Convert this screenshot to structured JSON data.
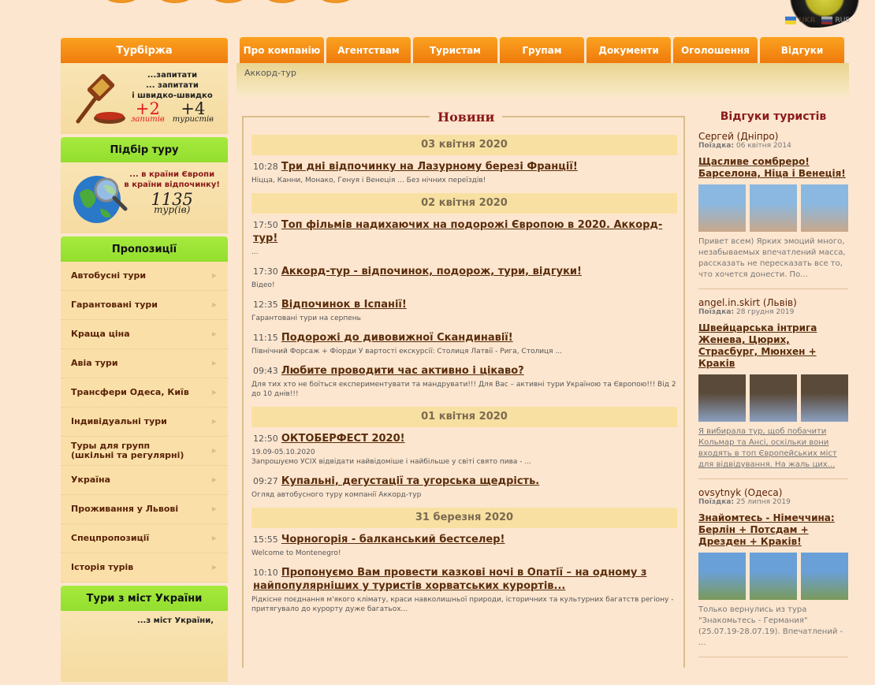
{
  "colors": {
    "accent_orange": "#f07c0e",
    "accent_green": "#9ee53a",
    "link": "#5a2d0c",
    "heading": "#8b1a1a",
    "background": "#fde6cf"
  },
  "languages": [
    {
      "code": "UKR",
      "icon": "flag-ukraine-icon"
    },
    {
      "code": "RUS",
      "icon": "flag-russia-icon"
    }
  ],
  "nav": {
    "tabs": [
      "Про компанію",
      "Агентствам",
      "Туристам",
      "Групам",
      "Документи",
      "Оголошення",
      "Відгуки"
    ]
  },
  "breadcrumb": "Аккорд-тур",
  "sidebar": {
    "turbirzha": {
      "title": "Турбіржа",
      "lines": [
        "...запитати",
        "... запитати",
        "і швидко-швидко"
      ],
      "requests_count": "+2",
      "requests_label": "запитів",
      "tourists_count": "+4",
      "tourists_label": "туристів"
    },
    "tour_search": {
      "title": "Підбір туру",
      "lines": [
        "... в країни Європи",
        "в країни відпочинку!"
      ],
      "count": "1135",
      "count_label": "тур(ів)"
    },
    "offers": {
      "title": "Пропозиції",
      "items": [
        "Автобусні тури",
        "Гарантовані тури",
        "Краща ціна",
        "Авіа тури",
        "Трансфери Одеса, Київ",
        "Індивідуальні тури",
        "Туры для групп\n(шкільні та регулярні)",
        "Україна",
        "Проживання у Львові",
        "Спецпропозиції",
        "Історія турів"
      ]
    },
    "cities": {
      "title": "Тури з міст України",
      "line": "...з міст України,"
    }
  },
  "news": {
    "title": "Новини",
    "groups": [
      {
        "date": "03 квітня 2020",
        "items": [
          {
            "time": "10:28",
            "title": "Три дні відпочинку на Лазурному березі Франції!",
            "desc": "Ніцца, Канни, Монако, Генуя і Венеція ... Без нічних переїздів!"
          }
        ]
      },
      {
        "date": "02 квітня 2020",
        "items": [
          {
            "time": "17:50",
            "title": "Топ фільмів надихаючих на подорожі Європою в 2020. Аккорд-тур!",
            "desc": "..."
          },
          {
            "time": "17:30",
            "title": "Аккорд-тур - відпочинок, подорож, тури, відгуки!",
            "desc": "Відео!"
          },
          {
            "time": "12:35",
            "title": "Відпочинок в Іспанії!",
            "desc": "Гарантовані тури на серпень"
          },
          {
            "time": "11:15",
            "title": "Подорожі до дивовижної Скандинавії!",
            "desc": "Північний Форсаж + Фіорди У вартості екскурсії:  Столиця Латвії - Рига, Столиця ..."
          },
          {
            "time": "09:43",
            "title": "Любите проводити час активно і цікаво?",
            "desc": "Для тих хто не боїться експериментувати та мандрувати!!! Для Вас – активні тури Україною та Європою!!! Від 2 до 10 днів!!!"
          }
        ]
      },
      {
        "date": "01 квітня 2020",
        "items": [
          {
            "time": "12:50",
            "title": "ОКТОБЕРФЕСТ 2020!",
            "desc": "19.09-05.10.2020\nЗапрошуємо УСІХ відвідати найвідоміше і найбільше у світі свято пива - ..."
          },
          {
            "time": "09:27",
            "title": "Купальні, дегустації та угорська щедрість.",
            "desc": "Огляд автобусного туру компанії Аккорд-тур"
          }
        ]
      },
      {
        "date": "31 березня 2020",
        "items": [
          {
            "time": "15:55",
            "title": "Чорногорія - балканський бестселер!",
            "desc": "Welcome to Montenegro!"
          },
          {
            "time": "10:10",
            "title": "Пропонуємо Вам провести казкові ночі в Опатії – на одному з найпопулярніших у туристів хорватських курортів...",
            "desc": "Рідкісне поєднання м'якого клімату, краси навколишньої природи, історичних та культурних багатств регіону -  притягувало до курорту дуже багатьох..."
          }
        ]
      }
    ]
  },
  "reviews": {
    "title": "Відгуки туристів",
    "trip_label": "Поїздка:",
    "items": [
      {
        "author": "Сергей (Дніпро)",
        "date": "06 квітня 2014",
        "title": "Щасливе сомбреро! Барселона, Ніца і Венеція!",
        "text": "Привет всем) Ярких эмоций много, незабываемых впечатлений масса, рассказать не пересказать все то, что хочется донести. По...",
        "text_link": false
      },
      {
        "author": "angel.in.skirt (Львів)",
        "date": "28 грудня 2019",
        "title": "Швейцарська інтрига Женева, Цюрих, Страсбург, Мюнхен + Краків",
        "text": "Я вибирала тур, щоб побачити Кольмар та Ансі, оскільки вони входять в топ Європейських міст для відвідування. На жаль цих...",
        "text_link": true
      },
      {
        "author": "ovsytnyk (Одеса)",
        "date": "25 липня 2019",
        "title": "Знайомтесь - Німеччина: Берлін + Потсдам + Дрезден + Краків!",
        "text": "Только вернулись из тура \"Знакомьтесь - Германия\" (25.07.19-28.07.19). Впечатлений - ...",
        "text_link": false
      }
    ]
  }
}
